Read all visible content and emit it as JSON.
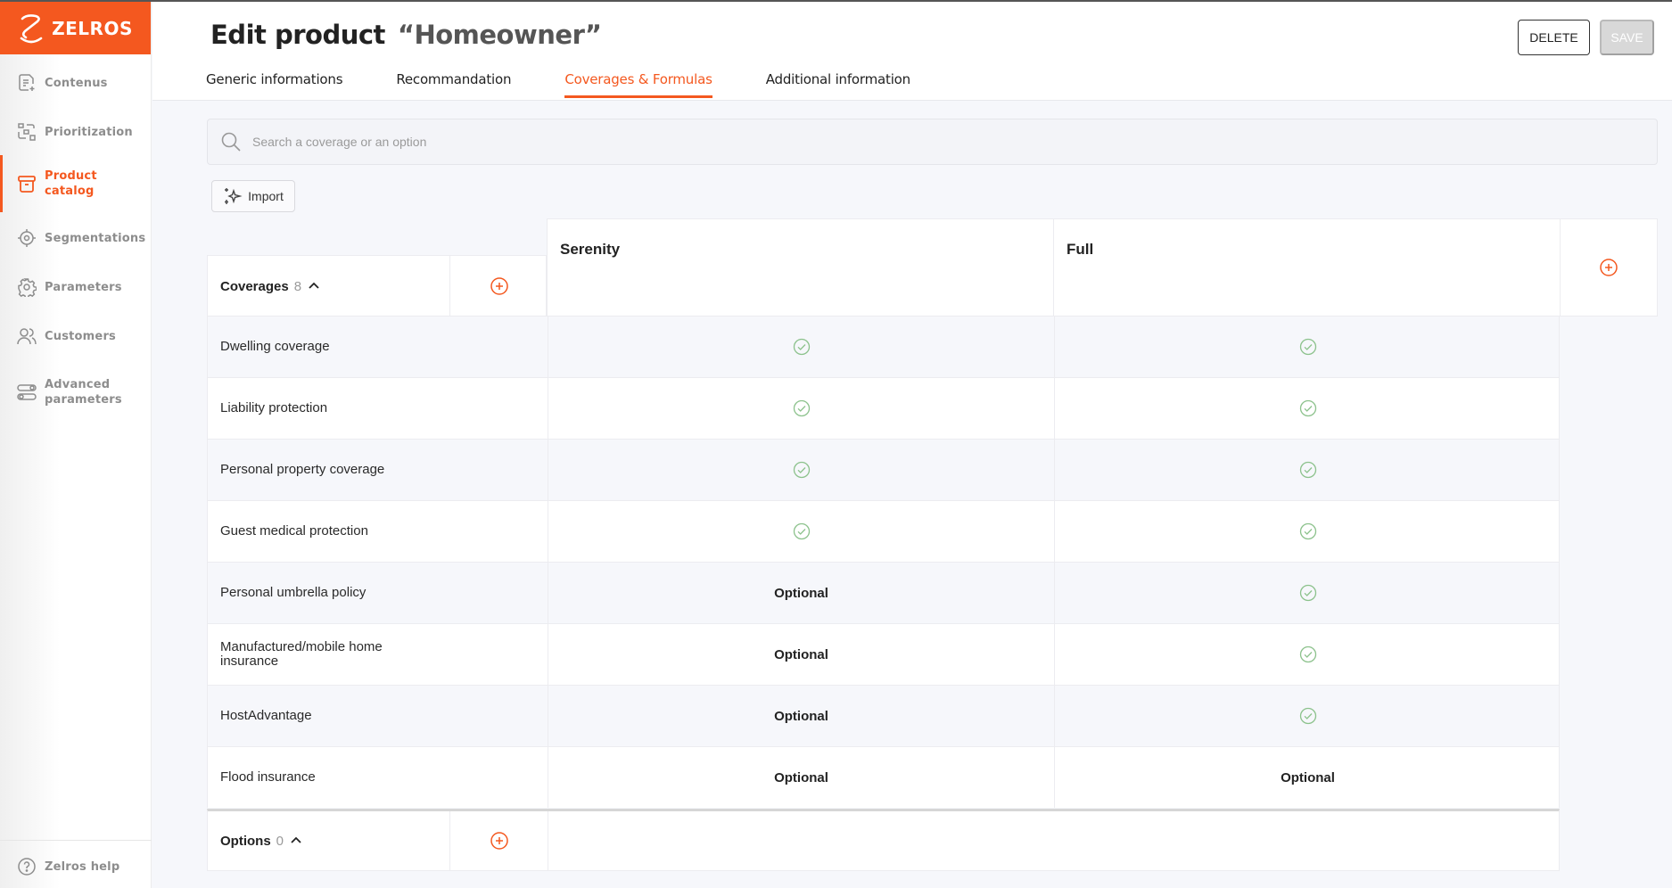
{
  "app": {
    "brand": "ZELROS",
    "colors": {
      "accent": "#f4581f",
      "check": "#8cc28c",
      "muted": "#8d8d8d"
    }
  },
  "sidebar": {
    "items": [
      {
        "label": "Contenus",
        "icon": "document-plus-icon",
        "active": false
      },
      {
        "label": "Prioritization",
        "icon": "prioritization-icon",
        "active": false
      },
      {
        "label": "Product catalog",
        "icon": "archive-box-icon",
        "active": true
      },
      {
        "label": "Segmentations",
        "icon": "target-icon",
        "active": false
      },
      {
        "label": "Parameters",
        "icon": "gear-icon",
        "active": false
      },
      {
        "label": "Customers",
        "icon": "users-icon",
        "active": false
      },
      {
        "label": "Advanced parameters",
        "icon": "toggles-icon",
        "active": false
      }
    ],
    "help": {
      "label": "Zelros help",
      "icon": "question-circle-icon"
    }
  },
  "header": {
    "title_prefix": "Edit product",
    "title_quoted": "“Homeowner”",
    "tabs": [
      {
        "label": "Generic informations",
        "active": false
      },
      {
        "label": "Recommandation",
        "active": false
      },
      {
        "label": "Coverages & Formulas",
        "active": true
      },
      {
        "label": "Additional information",
        "active": false
      }
    ],
    "delete_label": "DELETE",
    "save_label": "SAVE",
    "save_disabled": true
  },
  "search": {
    "placeholder": "Search a coverage or an option",
    "value": ""
  },
  "import_label": "Import",
  "table": {
    "plans": [
      "Serenity",
      "Full"
    ],
    "coverages_group": {
      "title": "Coverages",
      "count": "8",
      "expanded": true
    },
    "coverages": [
      {
        "name": "Dwelling coverage",
        "values": [
          "included",
          "included"
        ]
      },
      {
        "name": "Liability protection",
        "values": [
          "included",
          "included"
        ]
      },
      {
        "name": "Personal property coverage",
        "values": [
          "included",
          "included"
        ]
      },
      {
        "name": "Guest medical protection",
        "values": [
          "included",
          "included"
        ]
      },
      {
        "name": "Personal umbrella policy",
        "values": [
          "Optional",
          "included"
        ]
      },
      {
        "name": "Manufactured/mobile home insurance",
        "values": [
          "Optional",
          "included"
        ]
      },
      {
        "name": "HostAdvantage",
        "values": [
          "Optional",
          "included"
        ]
      },
      {
        "name": "Flood insurance",
        "values": [
          "Optional",
          "Optional"
        ]
      }
    ],
    "options_group": {
      "title": "Options",
      "count": "0",
      "expanded": true
    }
  }
}
